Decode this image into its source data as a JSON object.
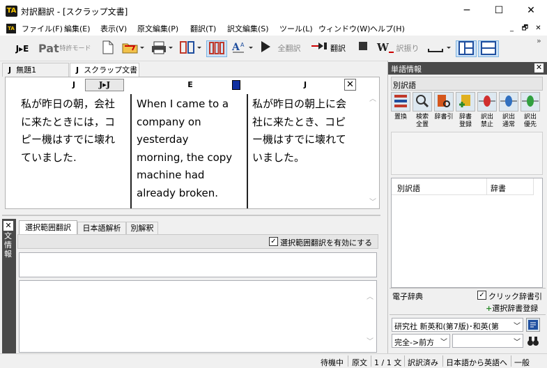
{
  "window": {
    "title": "対訳翻訳 - [スクラップ文書]",
    "app_icon_text": "TA",
    "controls": {
      "minimize": "─",
      "maximize": "☐",
      "close": "✕"
    }
  },
  "menu": {
    "items": [
      "ファイル(F)",
      "編集(E)",
      "表示(V)",
      "原文編集(P)",
      "翻訳(T)",
      "訳文編集(S)",
      "ツール(L)",
      "ウィンドウ(W)",
      "ヘルプ(H)"
    ],
    "mdi": {
      "minimize": "_",
      "restore": "🗗",
      "close": "✕"
    }
  },
  "toolbar": {
    "je_label": "J▸E",
    "pat_label": "Pat",
    "patent_mode": "特許モード",
    "full_translate": "全翻訳",
    "translate": "翻訳",
    "reword": "訳振り",
    "overflow": "»"
  },
  "tabs": [
    {
      "lang": "J",
      "label": "無題1"
    },
    {
      "lang": "J",
      "label": "スクラップ文書"
    }
  ],
  "document": {
    "col1_header": "J",
    "col_header_btn": "J▸J",
    "col2_header": "E",
    "col3_header": "J",
    "col1_text": "私が昨日の朝，会社\nに来たときには，コ\nピー機はすでに壊れ\nていました.",
    "col2_text": "When I came to a\ncompany on\nyesterday\nmorning, the copy\nmachine had\nalready broken.",
    "col3_text": "私が昨日の朝上に会\n社に来たとき、コピ\nー機はすでに壊れて\nいました。"
  },
  "info_panel": {
    "side_label": "文情報",
    "tabs": [
      "選択範囲翻訳",
      "日本語解析",
      "別解釈"
    ],
    "checkbox_label": "選択範囲翻訳を有効にする",
    "checkbox_checked": true
  },
  "word_panel": {
    "title": "単語情報",
    "alt_words_label": "別訳語",
    "buttons": [
      {
        "label1": "置換",
        "label2": "",
        "icon": "replace-icon"
      },
      {
        "label1": "検索",
        "label2": "全置",
        "icon": "search-replace-icon"
      },
      {
        "label1": "辞書引",
        "label2": "",
        "icon": "dictionary-lookup-icon"
      },
      {
        "label1": "辞書",
        "label2": "登録",
        "icon": "dictionary-register-icon"
      },
      {
        "label1": "訳出",
        "label2": "禁止",
        "icon": "forbid-pin-icon"
      },
      {
        "label1": "訳出",
        "label2": "通常",
        "icon": "normal-pin-icon"
      },
      {
        "label1": "訳出",
        "label2": "優先",
        "icon": "priority-pin-icon"
      }
    ],
    "list_headers": [
      "別訳語",
      "辞書"
    ]
  },
  "edict": {
    "title": "電子辞典",
    "click_lookup": "クリック辞書引",
    "click_checked": true,
    "register_btn": "選択辞書登録",
    "dictionary": "研究社 新英和(第7版)･和英(第",
    "match_mode": "完全->前方",
    "search_value": ""
  },
  "status": {
    "items": [
      "待機中",
      "原文",
      "1 / 1 文",
      "訳訳済み",
      "日本語から英語へ",
      "一般"
    ]
  }
}
